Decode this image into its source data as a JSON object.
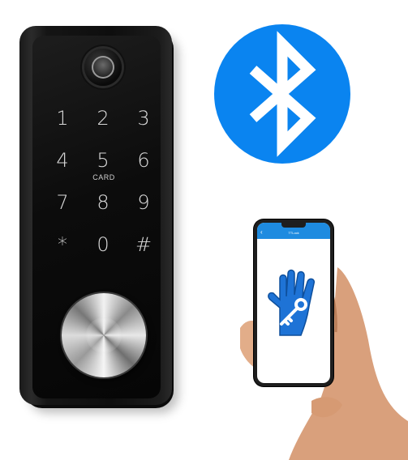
{
  "lock": {
    "keys": [
      "1",
      "2",
      "3",
      "4",
      "5",
      "6",
      "7",
      "8",
      "9",
      "*",
      "0",
      "#"
    ],
    "card_label": "CARD"
  },
  "phone": {
    "app_title": "TTLock",
    "back_glyph": "‹"
  },
  "icons": {
    "fingerprint": "fingerprint-sensor-icon",
    "bluetooth": "bluetooth-icon",
    "app_logo": "hand-key-icon"
  },
  "colors": {
    "bluetooth_blue": "#0a84f0",
    "app_blue": "#1e8be0",
    "lock_black": "#0c0c0c"
  }
}
